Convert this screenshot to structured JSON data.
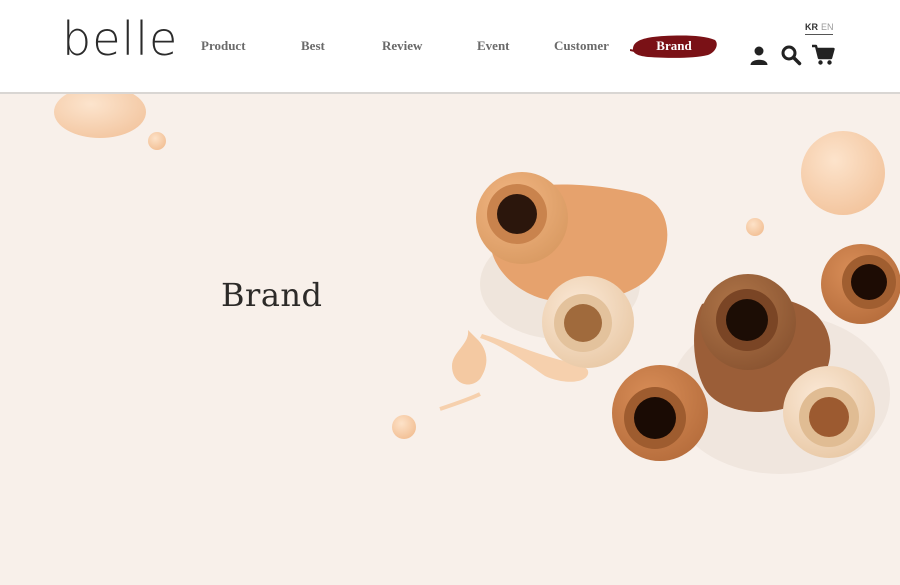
{
  "header": {
    "logo": "belle",
    "nav": [
      "Product",
      "Best",
      "Review",
      "Event",
      "Customer"
    ],
    "nav_active": "Brand",
    "lang": {
      "kr": "KR",
      "en": "EN"
    },
    "icons": [
      "user-icon",
      "search-icon",
      "cart-icon"
    ]
  },
  "hero": {
    "title": "Brand"
  },
  "colors": {
    "brand_accent": "#7a1116",
    "hero_bg": "#f8f0ea",
    "nav_text": "#6a6a6a"
  }
}
